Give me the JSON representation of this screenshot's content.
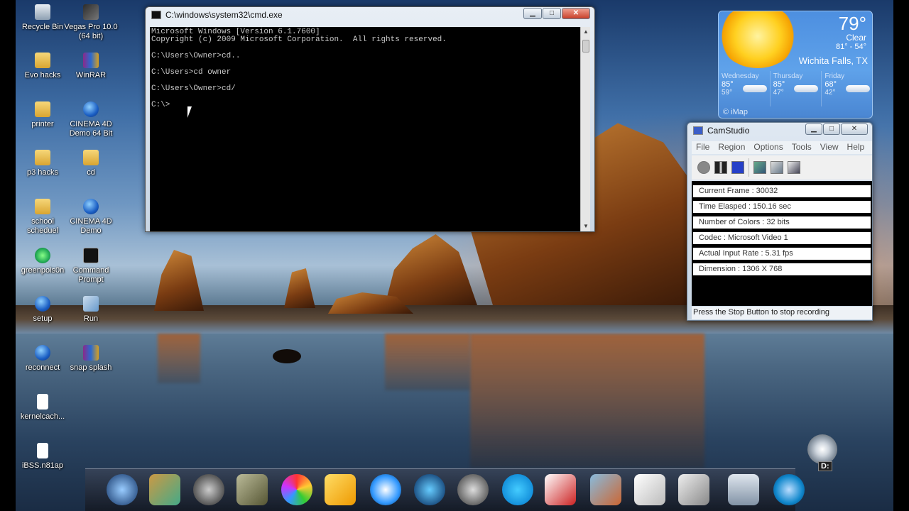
{
  "desktop_icons": [
    {
      "label": "Recycle Bin",
      "icon": "recycle-bin-icon"
    },
    {
      "label": "Vegas Pro 10.0 (64 bit)",
      "icon": "vegas-pro-icon"
    },
    {
      "label": "Evo hacks",
      "icon": "folder-icon"
    },
    {
      "label": "WinRAR",
      "icon": "winrar-icon"
    },
    {
      "label": "printer",
      "icon": "folder-icon"
    },
    {
      "label": "CINEMA 4D Demo 64 Bit",
      "icon": "cinema4d-icon"
    },
    {
      "label": "p3 hacks",
      "icon": "folder-icon"
    },
    {
      "label": "cd",
      "icon": "folder-icon"
    },
    {
      "label": "school scheduel",
      "icon": "folder-icon"
    },
    {
      "label": "CINEMA 4D Demo",
      "icon": "cinema4d-icon"
    },
    {
      "label": "greenpois0n",
      "icon": "greenpoison-icon"
    },
    {
      "label": "Command Prompt",
      "icon": "cmd-icon"
    },
    {
      "label": "setup",
      "icon": "globe-icon"
    },
    {
      "label": "Run",
      "icon": "run-icon"
    },
    {
      "label": "reconnect",
      "icon": "ie-icon"
    },
    {
      "label": "snap splash",
      "icon": "winrar-icon"
    },
    {
      "label": "kernelcach...",
      "icon": "file-icon"
    },
    {
      "label": "iBSS.n81ap",
      "icon": "file-icon"
    }
  ],
  "cmd": {
    "title": "C:\\windows\\system32\\cmd.exe",
    "lines": [
      "Microsoft Windows [Version 6.1.7600]",
      "Copyright (c) 2009 Microsoft Corporation.  All rights reserved.",
      "",
      "C:\\Users\\Owner>cd..",
      "",
      "C:\\Users>cd owner",
      "",
      "C:\\Users\\Owner>cd/",
      "",
      "C:\\>"
    ]
  },
  "weather": {
    "temp": "79°",
    "condition": "Clear",
    "hilo": "81° - 54°",
    "city": "Wichita Falls, TX",
    "days": [
      {
        "name": "Wednesday",
        "hi": "85°",
        "lo": "59°"
      },
      {
        "name": "Thursday",
        "hi": "85°",
        "lo": "47°"
      },
      {
        "name": "Friday",
        "hi": "68°",
        "lo": "42°"
      }
    ],
    "brand": "© iMap"
  },
  "camstudio": {
    "title": "CamStudio",
    "menu": [
      "File",
      "Region",
      "Options",
      "Tools",
      "View",
      "Help"
    ],
    "stats": [
      "Current Frame : 30032",
      "Time Elasped  : 150.16 sec",
      "Number of Colors  : 32 bits",
      "Codec  : Microsoft Video 1",
      "Actual Input Rate  : 5.31 fps",
      "Dimension  : 1306 X 768"
    ],
    "status": "Press the Stop Button to stop recording"
  },
  "drive": {
    "label": "D:"
  },
  "window_controls": {
    "minimize": "▁",
    "maximize": "□",
    "close": "✕"
  },
  "dock_apps": [
    "globe-icon",
    "books-icon",
    "headphones-icon",
    "gimp-icon",
    "pinwheel-icon",
    "outlook-icon",
    "safari-icon",
    "itunes-icon",
    "film-reel-icon",
    "skype-icon",
    "cards-icon",
    "video-editor-icon",
    "notepad-icon",
    "help-icon",
    "trash-icon",
    "ie-icon"
  ]
}
